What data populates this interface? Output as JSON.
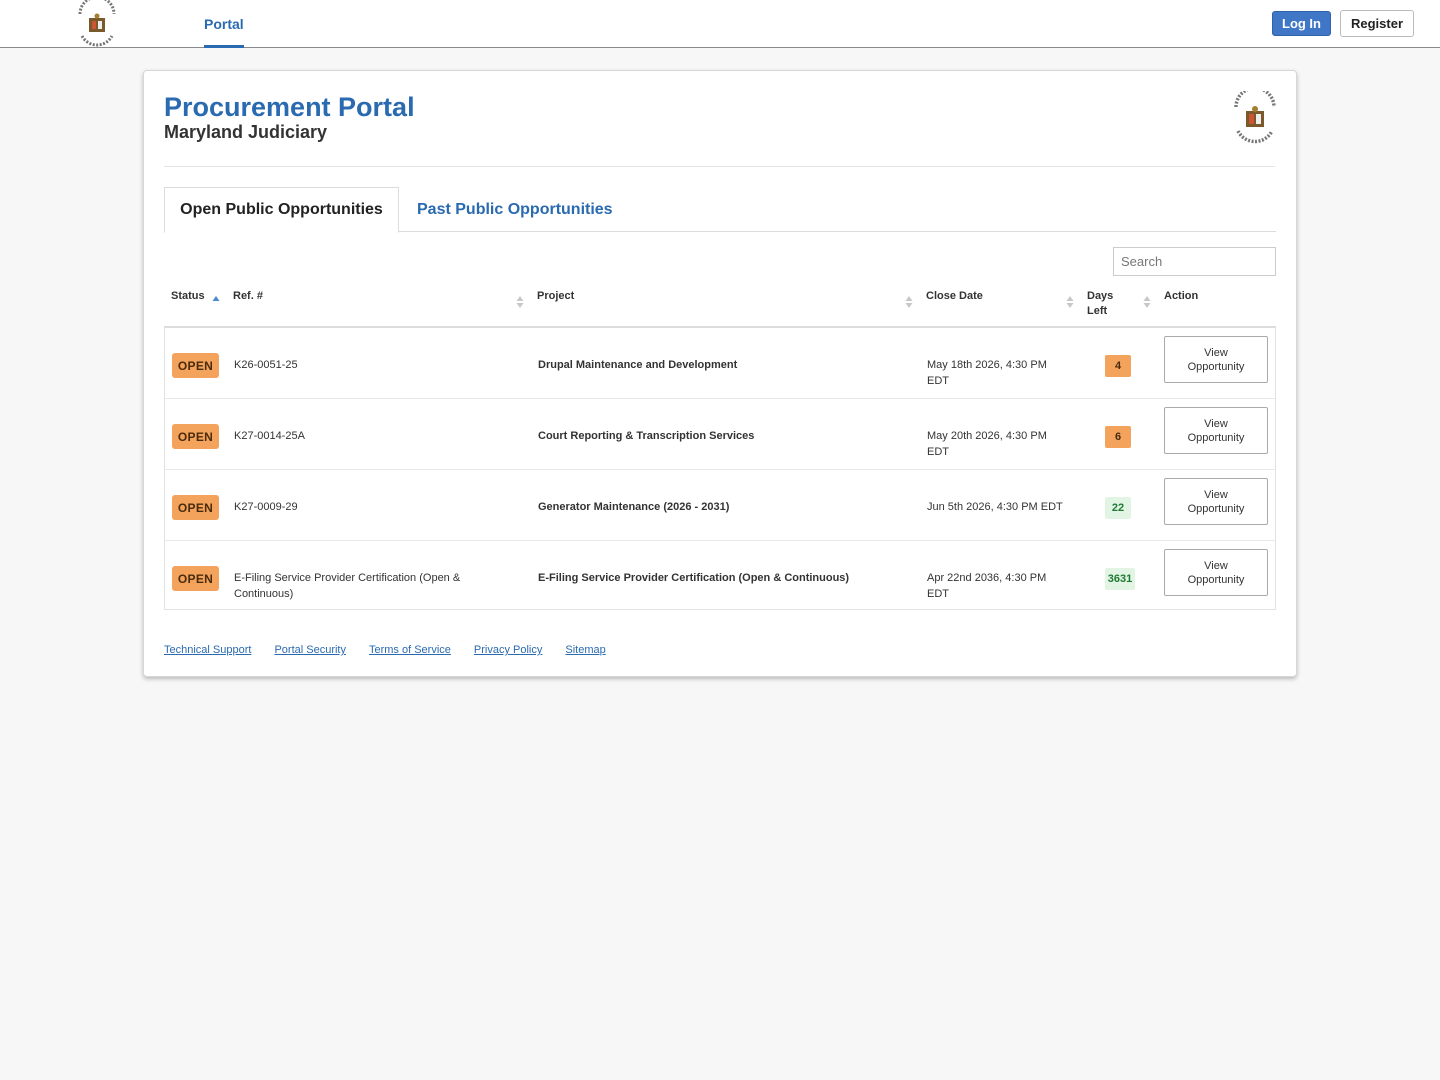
{
  "nav": {
    "logo_icon": "maryland-judiciary-seal-icon",
    "tab_label": "Portal",
    "login_label": "Log In",
    "register_label": "Register"
  },
  "header": {
    "title": "Procurement Portal",
    "subtitle": "Maryland Judiciary",
    "logo_icon": "maryland-judiciary-seal-icon"
  },
  "tabs": [
    {
      "label": "Open Public Opportunities",
      "active": true
    },
    {
      "label": "Past Public Opportunities",
      "active": false
    }
  ],
  "search": {
    "placeholder": "Search",
    "value": ""
  },
  "table": {
    "columns": [
      {
        "label": "Status",
        "sort": "ascending"
      },
      {
        "label": "Ref. #",
        "sort": "none"
      },
      {
        "label": "Project",
        "sort": "none"
      },
      {
        "label": "Close Date",
        "sort": "none"
      },
      {
        "label": "Days Left",
        "sort": "none"
      },
      {
        "label": "Action",
        "sort": "none"
      }
    ],
    "rows": [
      {
        "status": "OPEN",
        "ref": "K26-0051-25",
        "project": "Drupal Maintenance and Development",
        "close_date": "May 18th 2026, 4:30 PM EDT",
        "days_left": "4",
        "days_state": "warn",
        "action": "View Opportunity"
      },
      {
        "status": "OPEN",
        "ref": "K27-0014-25A",
        "project": "Court Reporting & Transcription Services",
        "close_date": "May 20th 2026, 4:30 PM EDT",
        "days_left": "6",
        "days_state": "warn",
        "action": "View Opportunity"
      },
      {
        "status": "OPEN",
        "ref": "K27-0009-29",
        "project": "Generator Maintenance (2026 - 2031)",
        "close_date": "Jun 5th 2026, 4:30 PM EDT",
        "days_left": "22",
        "days_state": "ok",
        "action": "View Opportunity"
      },
      {
        "status": "OPEN",
        "ref": "E-Filing Service Provider Certification (Open & Continuous)",
        "project": "E-Filing Service Provider Certification (Open & Continuous)",
        "close_date": "Apr 22nd 2036, 4:30 PM EDT",
        "days_left": "3631",
        "days_state": "ok",
        "action": "View Opportunity"
      }
    ]
  },
  "footer": {
    "links": [
      "Technical Support",
      "Portal Security",
      "Terms of Service",
      "Privacy Policy",
      "Sitemap"
    ]
  },
  "colors": {
    "brand_blue": "#2a6ab0",
    "login_blue": "#3f77c6",
    "open_badge": "#f3a35b",
    "days_ok_bg": "#e2f4e4",
    "days_ok_text": "#1f7a33"
  }
}
